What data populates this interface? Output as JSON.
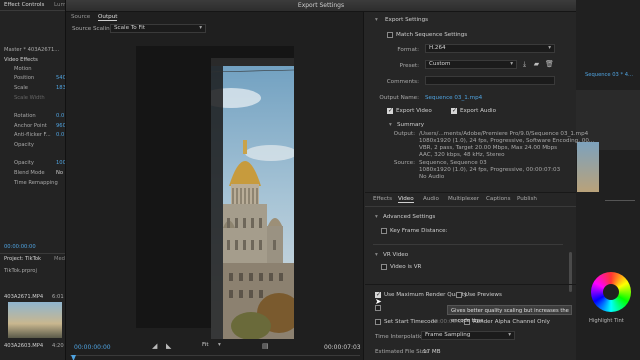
{
  "dialog": {
    "title": "Export Settings"
  },
  "preview": {
    "tabs": [
      "Source",
      "Output"
    ],
    "scaling_label": "Source Scaling:",
    "scaling_value": "Scale To Fit",
    "time_left": "00:00:00:00",
    "time_right": "00:00:07:03",
    "fit_value": "Fit"
  },
  "export_settings": {
    "section_title": "Export Settings",
    "match_sequence": "Match Sequence Settings",
    "format_label": "Format:",
    "format_value": "H.264",
    "preset_label": "Preset:",
    "preset_value": "Custom",
    "comments_label": "Comments:",
    "output_name_label": "Output Name:",
    "output_name_value": "Sequence 03_1.mp4",
    "export_video": "Export Video",
    "export_audio": "Export Audio"
  },
  "summary": {
    "title": "Summary",
    "output_label": "Output:",
    "output_lines": [
      "/Users/...ments/Adobe/Premiere Pro/9.0/Sequence 03_1.mp4",
      "1080x1920 (1.0), 24 fps, Progressive, Software Encoding, 00...",
      "VBR, 2 pass, Target 20.00 Mbps, Max 24.00 Mbps",
      "AAC, 320 kbps, 48 kHz, Stereo"
    ],
    "source_label": "Source:",
    "source_lines": [
      "Sequence, Sequence 03",
      "1080x1920 (1.0), 24 fps, Progressive, 00:00:07:03",
      "No Audio"
    ]
  },
  "settings_tabs": [
    "Effects",
    "Video",
    "Audio",
    "Multiplexer",
    "Captions",
    "Publish"
  ],
  "video_tab": {
    "advanced_title": "Advanced Settings",
    "key_frame_distance": "Key Frame Distance:",
    "vr_title": "VR Video",
    "video_is_vr": "Video is VR"
  },
  "bottom": {
    "max_render_quality": "Use Maximum Render Quality",
    "use_previews": "Use Previews",
    "tooltip": "Gives better quality scaling but increases the encode time.",
    "set_start_timecode": "Set Start Timecode",
    "start_timecode_value": "00:00:00:00",
    "render_alpha": "Render Alpha Channel Only",
    "time_interp_label": "Time Interpolation:",
    "time_interp_value": "Frame Sampling",
    "est_size_label": "Estimated File Size:",
    "est_size_value": "17 MB"
  },
  "background_left": {
    "tab1": "Effect Controls",
    "tab1_extra": "Lum",
    "master": "Master * 403A2671...",
    "video_effects": "Video Effects",
    "motion": "Motion",
    "position": "Position",
    "position_val": "540",
    "scale": "Scale",
    "scale_val": "183",
    "scale_width": "Scale Width",
    "rotation": "Rotation",
    "rotation_val": "0.0",
    "anchor": "Anchor Point",
    "anchor_val": "960",
    "anti_flicker": "Anti-flicker F...",
    "anti_flicker_val": "0.0",
    "opacity": "Opacity",
    "opacity_sub": "Opacity",
    "opacity_val": "100",
    "blend": "Blend Mode",
    "blend_val": "No",
    "time_remap": "Time Remapping",
    "timecode": "00:00:00:00",
    "project_tab": "Project: TikTok",
    "project_extra": "Med",
    "project_file": "TikTok.prproj",
    "clip1": "403A2671.MP4",
    "clip1_dur": "6:01",
    "clip2": "403A2603.MP4",
    "clip2_dur": "4:20"
  },
  "background_right": {
    "seq_tab": "Sequence 03 * 4...",
    "highlight_tint": "Highlight Tint"
  },
  "colors": {
    "accent": "#4fa3e0",
    "panel": "#262626",
    "dark": "#1d1d1d"
  }
}
